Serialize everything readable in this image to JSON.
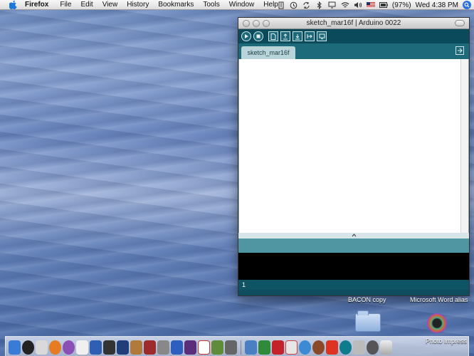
{
  "menubar": {
    "app_name": "Firefox",
    "items": [
      "File",
      "Edit",
      "View",
      "History",
      "Bookmarks",
      "Tools",
      "Window",
      "Help"
    ],
    "battery": "(97%)",
    "clock": "Wed 4:38 PM"
  },
  "window": {
    "title": "sketch_mar16f | Arduino 0022",
    "tab_label": "sketch_mar16f",
    "line_number": "1",
    "toolbar_buttons": [
      "verify",
      "stop",
      "new",
      "open",
      "save",
      "upload",
      "serial-monitor"
    ]
  },
  "desktop": {
    "labels": [
      "BACON copy",
      "Microsoft Word alias"
    ]
  },
  "dock": {
    "hover_label": "Photo Impress",
    "icons": [
      "finder",
      "dashboard",
      "preview",
      "firefox",
      "itunes",
      "textedit",
      "word",
      "terminal",
      "photoshop",
      "address-book",
      "photo-booth",
      "preferences",
      "quicktime",
      "imovie",
      "calendar",
      "iphoto",
      "calculator",
      "mail",
      "excel",
      "acrobat",
      "filesmerge",
      "safari",
      "paint",
      "itunes-2",
      "r-app",
      "arduino",
      "downloads",
      "photo-impress",
      "trash"
    ]
  },
  "colors": {
    "arduino_teal": "#0f4d5e",
    "arduino_tab": "#b9d4d9",
    "message_area": "#4f95a2"
  }
}
